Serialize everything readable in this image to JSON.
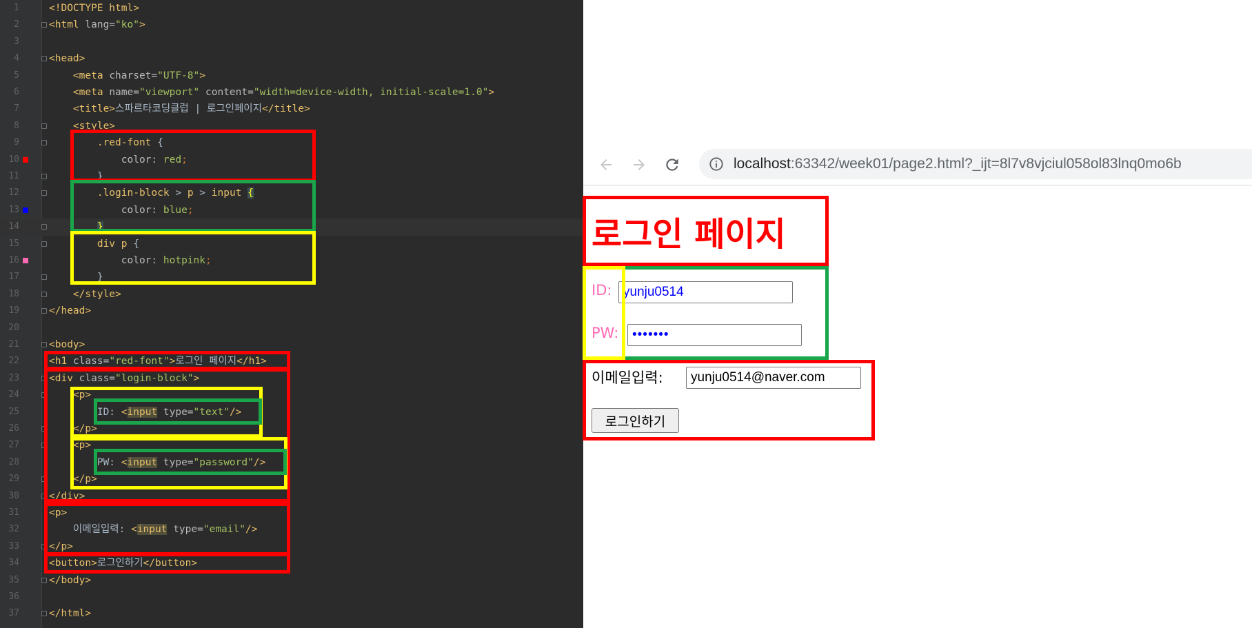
{
  "editor": {
    "lines": [
      {
        "n": "1",
        "parts": [
          [
            "t",
            "<!DOCTYPE html>"
          ]
        ]
      },
      {
        "n": "2",
        "parts": [
          [
            "t",
            "<html "
          ],
          [
            "a",
            "lang="
          ],
          [
            "v",
            "\"ko\""
          ],
          [
            "t",
            ">"
          ]
        ]
      },
      {
        "n": "3",
        "parts": []
      },
      {
        "n": "4",
        "parts": [
          [
            "t",
            "<head>"
          ]
        ]
      },
      {
        "n": "5",
        "parts": [
          [
            "txt",
            "    "
          ],
          [
            "t",
            "<meta "
          ],
          [
            "a",
            "charset="
          ],
          [
            "v",
            "\"UTF-8\""
          ],
          [
            "t",
            ">"
          ]
        ]
      },
      {
        "n": "6",
        "parts": [
          [
            "txt",
            "    "
          ],
          [
            "t",
            "<meta "
          ],
          [
            "a",
            "name="
          ],
          [
            "v",
            "\"viewport\" "
          ],
          [
            "a",
            "content="
          ],
          [
            "v",
            "\"width=device-width, initial-scale=1.0\""
          ],
          [
            "t",
            ">"
          ]
        ]
      },
      {
        "n": "7",
        "parts": [
          [
            "txt",
            "    "
          ],
          [
            "t",
            "<title>"
          ],
          [
            "txt",
            "스파르타코딩클럽 | 로그인페이지"
          ],
          [
            "t",
            "</title>"
          ]
        ]
      },
      {
        "n": "8",
        "parts": [
          [
            "txt",
            "    "
          ],
          [
            "t",
            "<style>"
          ]
        ]
      },
      {
        "n": "9",
        "parts": [
          [
            "txt",
            "        "
          ],
          [
            "c",
            ".red-font "
          ],
          [
            "txt",
            "{"
          ]
        ]
      },
      {
        "n": "10",
        "parts": [
          [
            "txt",
            "            "
          ],
          [
            "a",
            "color"
          ],
          [
            "txt",
            ": "
          ],
          [
            "v",
            "red"
          ],
          [
            "p",
            ";"
          ]
        ]
      },
      {
        "n": "11",
        "parts": [
          [
            "txt",
            "        }"
          ]
        ]
      },
      {
        "n": "12",
        "parts": [
          [
            "txt",
            "        "
          ],
          [
            "c",
            ".login-block "
          ],
          [
            "txt",
            "> "
          ],
          [
            "c",
            "p "
          ],
          [
            "txt",
            "> "
          ],
          [
            "c",
            "input "
          ],
          [
            "brace-hl",
            "{"
          ]
        ]
      },
      {
        "n": "13",
        "parts": [
          [
            "txt",
            "            "
          ],
          [
            "a",
            "color"
          ],
          [
            "txt",
            ": "
          ],
          [
            "v",
            "blue"
          ],
          [
            "p",
            ";"
          ]
        ]
      },
      {
        "n": "14",
        "parts": [
          [
            "txt",
            "        "
          ],
          [
            "brace-hl",
            "}"
          ]
        ]
      },
      {
        "n": "15",
        "parts": [
          [
            "txt",
            "        "
          ],
          [
            "c",
            "div p "
          ],
          [
            "txt",
            "{"
          ]
        ]
      },
      {
        "n": "16",
        "parts": [
          [
            "txt",
            "            "
          ],
          [
            "a",
            "color"
          ],
          [
            "txt",
            ": "
          ],
          [
            "v",
            "hotpink"
          ],
          [
            "p",
            ";"
          ]
        ]
      },
      {
        "n": "17",
        "parts": [
          [
            "txt",
            "        }"
          ]
        ]
      },
      {
        "n": "18",
        "parts": [
          [
            "txt",
            "    "
          ],
          [
            "t",
            "</style>"
          ]
        ]
      },
      {
        "n": "19",
        "parts": [
          [
            "t",
            "</head>"
          ]
        ]
      },
      {
        "n": "20",
        "parts": []
      },
      {
        "n": "21",
        "parts": [
          [
            "t",
            "<body>"
          ]
        ]
      },
      {
        "n": "22",
        "parts": [
          [
            "t",
            "<h1 "
          ],
          [
            "a",
            "class="
          ],
          [
            "v",
            "\"red-font\""
          ],
          [
            "t",
            ">"
          ],
          [
            "txt",
            "로그인 페이지"
          ],
          [
            "t",
            "</h1>"
          ]
        ]
      },
      {
        "n": "23",
        "parts": [
          [
            "t",
            "<div "
          ],
          [
            "a",
            "class="
          ],
          [
            "v",
            "\"login-block\""
          ],
          [
            "t",
            ">"
          ]
        ]
      },
      {
        "n": "24",
        "parts": [
          [
            "txt",
            "    "
          ],
          [
            "t",
            "<p>"
          ]
        ]
      },
      {
        "n": "25",
        "parts": [
          [
            "txt",
            "        ID: "
          ],
          [
            "t",
            "<"
          ],
          [
            "hl",
            "input"
          ],
          [
            "txt",
            " "
          ],
          [
            "a",
            "type="
          ],
          [
            "v",
            "\"text\""
          ],
          [
            "t",
            "/>"
          ]
        ]
      },
      {
        "n": "26",
        "parts": [
          [
            "txt",
            "    "
          ],
          [
            "t",
            "</p>"
          ]
        ]
      },
      {
        "n": "27",
        "parts": [
          [
            "txt",
            "    "
          ],
          [
            "t",
            "<p>"
          ]
        ]
      },
      {
        "n": "28",
        "parts": [
          [
            "txt",
            "        PW: "
          ],
          [
            "t",
            "<"
          ],
          [
            "hl",
            "input"
          ],
          [
            "txt",
            " "
          ],
          [
            "a",
            "type="
          ],
          [
            "v",
            "\"password\""
          ],
          [
            "t",
            "/>"
          ]
        ]
      },
      {
        "n": "29",
        "parts": [
          [
            "txt",
            "    "
          ],
          [
            "t",
            "</p>"
          ]
        ]
      },
      {
        "n": "30",
        "parts": [
          [
            "t",
            "</div>"
          ]
        ]
      },
      {
        "n": "31",
        "parts": [
          [
            "t",
            "<p>"
          ]
        ]
      },
      {
        "n": "32",
        "parts": [
          [
            "txt",
            "    이메일입력: "
          ],
          [
            "t",
            "<"
          ],
          [
            "hl",
            "input"
          ],
          [
            "txt",
            " "
          ],
          [
            "a",
            "type="
          ],
          [
            "v",
            "\"email\""
          ],
          [
            "t",
            "/>"
          ]
        ]
      },
      {
        "n": "33",
        "parts": [
          [
            "t",
            "</p>"
          ]
        ]
      },
      {
        "n": "34",
        "parts": [
          [
            "t",
            "<button>"
          ],
          [
            "txt",
            "로그인하기"
          ],
          [
            "t",
            "</button>"
          ]
        ]
      },
      {
        "n": "35",
        "parts": [
          [
            "t",
            "</body>"
          ]
        ]
      },
      {
        "n": "36",
        "parts": []
      },
      {
        "n": "37",
        "parts": [
          [
            "t",
            "</html>"
          ]
        ]
      }
    ],
    "current_line": "14",
    "color_markers": [
      {
        "line": "10",
        "color": "#ff0000"
      },
      {
        "line": "13",
        "color": "#0000ff"
      },
      {
        "line": "16",
        "color": "#ff69b4"
      }
    ],
    "fold_lines": [
      "2",
      "4",
      "8",
      "9",
      "11",
      "12",
      "14",
      "15",
      "17",
      "18",
      "19",
      "21",
      "23",
      "24",
      "26",
      "27",
      "29",
      "30",
      "33",
      "35",
      "37"
    ]
  },
  "browser": {
    "url_host": "localhost",
    "url_rest": ":63342/week01/page2.html?_ijt=8l7v8vjciul058ol83lnq0mo6b",
    "heading": "로그인 페이지",
    "id_label": "ID:",
    "id_value": "yunju0514",
    "pw_label": "PW:",
    "pw_value": "•••••••",
    "email_label": "이메일입력:",
    "email_value": "yunju0514@naver.com",
    "button_label": "로그인하기"
  },
  "colors": {
    "red_box": "#ff0000",
    "green_box": "#1aa64a",
    "yellow_box": "#ffff00",
    "heading_red": "#ff0000",
    "label_pink": "#ff69b4",
    "input_blue": "#0000ff"
  }
}
